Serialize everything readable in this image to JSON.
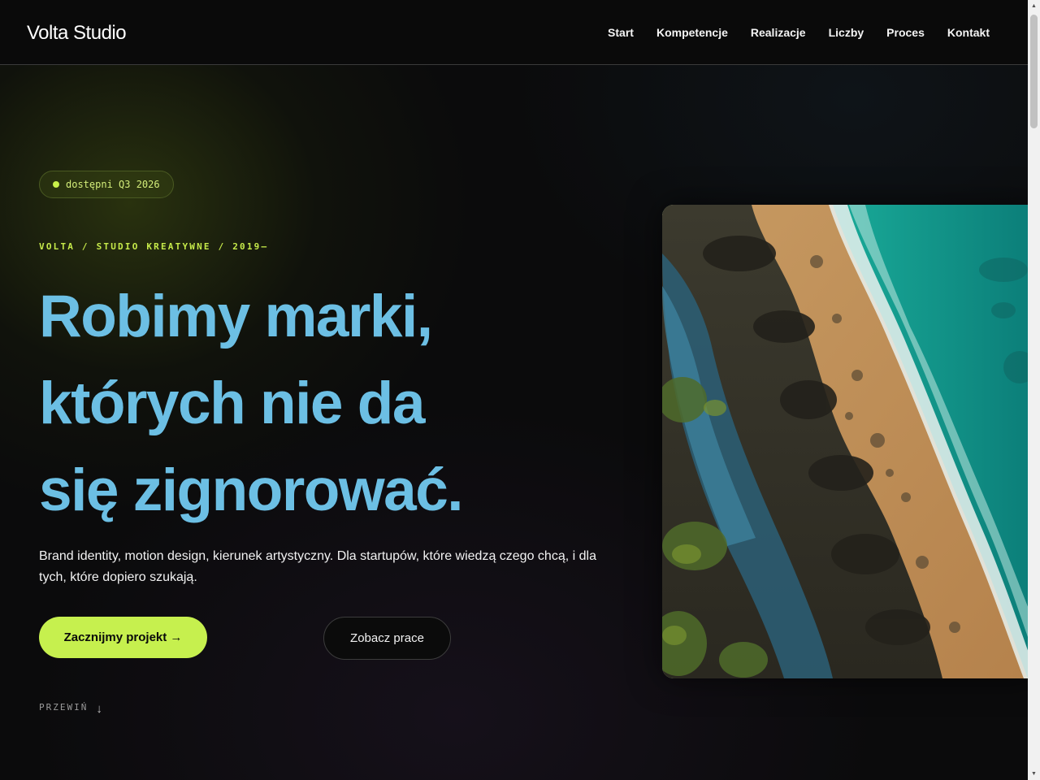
{
  "header": {
    "logo": "Volta Studio",
    "nav": [
      "Start",
      "Kompetencje",
      "Realizacje",
      "Liczby",
      "Proces",
      "Kontakt"
    ]
  },
  "hero": {
    "badge": "dostępni Q3 2026",
    "eyebrow": "VOLTA / STUDIO KREATYWNE / 2019—",
    "headline": [
      "Robimy marki,",
      "których nie da",
      "się zignorować."
    ],
    "lead": "Brand identity, motion design, kierunek artystyczny. Dla startupów, które wiedzą czego chcą, i dla tych, które dopiero szukają.",
    "primary_cta": "Zacznijmy projekt →",
    "secondary_cta": "Zobacz prace",
    "scroll_label": "PRZEWIŃ",
    "scroll_arrow": "↓",
    "image_subject": "aerial-beach-coastline"
  },
  "colors": {
    "accent": "#c6f04e",
    "headline": "#6cbfe4",
    "background": "#0b0b0c"
  },
  "scrollbar": {
    "up_arrow": "▲",
    "down_arrow": "▼"
  }
}
